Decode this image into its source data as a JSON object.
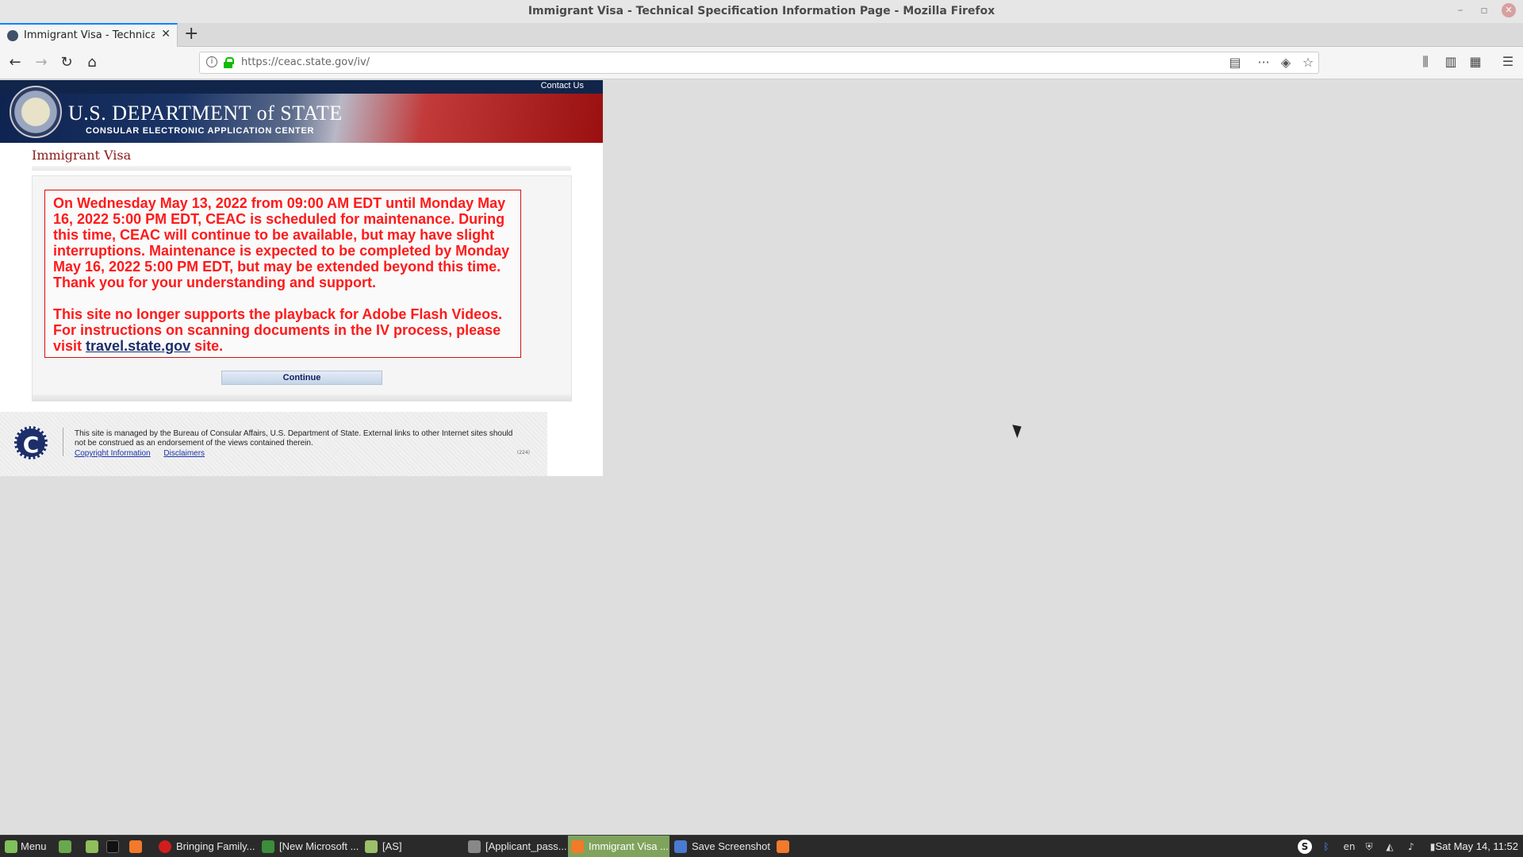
{
  "window": {
    "title": "Immigrant Visa - Technical Specification Information Page - Mozilla Firefox"
  },
  "tab": {
    "title": "Immigrant Visa - Technical Sp",
    "new_tab": "+"
  },
  "navbar": {
    "url": "https://ceac.state.gov/iv/"
  },
  "page": {
    "contact_link": "Contact Us",
    "banner_dept": "U.S. DEPARTMENT of STATE",
    "banner_sub": "CONSULAR ELECTRONIC APPLICATION CENTER",
    "section_title": "Immigrant Visa",
    "alert_para1": "On Wednesday May 13, 2022 from 09:00 AM EDT until Monday May 16, 2022 5:00 PM EDT, CEAC is scheduled for maintenance. During this time, CEAC will continue to be available, but may have slight interruptions. Maintenance is expected to be completed by Monday May 16, 2022 5:00 PM EDT, but may be extended beyond this time. Thank you for your understanding and support.",
    "alert_para2_before": "This site no longer supports the playback for Adobe Flash Videos. For instructions on scanning documents in the IV process, please visit ",
    "alert_link": "travel.state.gov",
    "alert_para2_after": " site.",
    "continue_label": "Continue",
    "footer_text": "This site is managed by the Bureau of Consular Affairs, U.S. Department of State. External links to other Internet sites should not be construed as an endorsement of the views contained therein.",
    "footer_link_copyright": "Copyright Information",
    "footer_link_disclaimers": "Disclaimers",
    "footer_version": "(224)",
    "footer_logo_letter": "C"
  },
  "taskbar": {
    "menu": "Menu",
    "items": [
      "Bringing Family...",
      "[New Microsoft ...",
      "[AS]",
      "[Applicant_pass...",
      "Immigrant Visa ...",
      "Save Screenshot"
    ],
    "lang": "en",
    "clock": "Sat May 14, 11:52"
  },
  "colors": {
    "alert_red": "#ff1a1a",
    "navy": "#11254a",
    "taskbar_active": "#7fa35c"
  }
}
